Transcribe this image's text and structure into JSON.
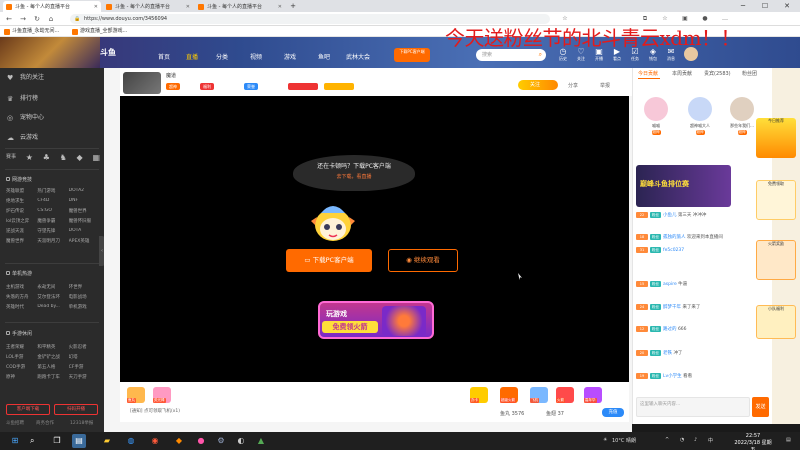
{
  "browser": {
    "tabs": [
      {
        "title": "斗鱼 - 每个人的直播平台",
        "active": true
      },
      {
        "title": "斗鱼 - 每个人的直播平台",
        "active": false
      },
      {
        "title": "斗鱼 - 每个人的直播平台",
        "active": false
      }
    ],
    "new_tab": "+",
    "url": "https://www.douyu.com/3456094",
    "bookmarks": [
      "斗鱼直播_永劫无间...",
      "游戏直播_全部游戏..."
    ]
  },
  "site": {
    "logo": "斗鱼",
    "nav": [
      "首页",
      "直播",
      "分类",
      "视频",
      "游戏",
      "鱼吧",
      "武林大会"
    ],
    "active_nav": "直播",
    "download_pc": "下载PC客户端",
    "search_placeholder": "搜索",
    "header_icons": [
      "历史",
      "关注",
      "开播",
      "看点",
      "任务",
      "钱包",
      "消息"
    ]
  },
  "sidebar": {
    "top_items": [
      {
        "icon": "♥",
        "label": "我的关注"
      },
      {
        "icon": "♛",
        "label": "排行榜"
      },
      {
        "icon": "◎",
        "label": "宠物中心"
      },
      {
        "icon": "☁",
        "label": "云游戏"
      }
    ],
    "quick_icons": [
      "赛事",
      "★",
      "♣",
      "♞",
      "◆",
      "▦"
    ],
    "section1": {
      "title": "网游竞技",
      "items": [
        "英雄联盟",
        "热门游戏",
        "DOTA2",
        "绝地求生",
        "CF4D",
        "DNF",
        "炉石传说",
        "CS:GO",
        "魔兽世界",
        "lol云顶之弈",
        "魔兽争霸",
        "魔兽怀旧服",
        "逆战天涯",
        "守望先锋",
        "DOTA",
        "魔兽世界",
        "天涯明月刀",
        "APEX英雄"
      ]
    },
    "section2": {
      "title": "单机热游",
      "items": [
        "主机游戏",
        "永劫无间",
        "环世界",
        "失落的方舟",
        "艾尔登法环",
        "电影战场",
        "英雄时代",
        "Dead by...",
        "单机游戏"
      ]
    },
    "section3": {
      "title": "手游休闲",
      "items": [
        "王者荣耀",
        "和平精英",
        "火影忍者",
        "LOL手游",
        "金铲铲之战",
        "幻塔",
        "COD手游",
        "第五人格",
        "CF手游",
        "原神",
        "跑跑卡丁车",
        "天刀手游"
      ]
    },
    "bottom_buttons": [
      "客户端下载",
      "扫码开播"
    ],
    "footer": [
      "斗鱼招聘",
      "商务合作",
      "12318举报"
    ]
  },
  "room": {
    "streamer": "魔道",
    "tags": [
      "超神",
      "福利",
      "荣誉"
    ],
    "follow": "关注",
    "share": "分享",
    "report": "举报"
  },
  "video": {
    "bubble_main": "还在卡顿吗？下载PC客户端",
    "bubble_sub": "去下载，看直播",
    "download_button": "下载PC客户端",
    "continue_button": "继续观看",
    "ad_line1": "玩游戏",
    "ad_line2": "免费领火箭"
  },
  "bottom_bar": {
    "gifts": [
      "鱼丸",
      "荧光棒",
      "办卡",
      "超级火箭",
      "飞机",
      "火箭",
      "嘉年华"
    ],
    "notice": "[通知] 点可领取飞机(x1)",
    "stats": [
      "鱼丸 3576",
      "鱼翅 37"
    ],
    "recharge": "充值"
  },
  "right_panel": {
    "tabs": [
      "今日贡献",
      "本周贡献",
      "贵宾(2583)",
      "粉丝团"
    ],
    "active_tab": "今日贡献",
    "contributors": [
      {
        "name": "喵喵",
        "badge": "超神"
      },
      {
        "name": "超神喵大人",
        "badge": "超神"
      },
      {
        "name": "那些年我们...",
        "badge": "超神"
      }
    ],
    "rank_banner": "巅峰斗鱼排位赛",
    "chat": [
      {
        "lv": "22",
        "fan": "粉丝",
        "user": "小鱼儿",
        "text": "第三天 冲冲冲"
      },
      {
        "lv": "18",
        "fan": "粉丝",
        "user": "孤独的旅人",
        "text": "欢迎来到本直播间"
      },
      {
        "lv": "31",
        "fan": "粉丝",
        "user": "fe5c0237",
        "text": ""
      },
      {
        "lv": "15",
        "fan": "粉丝",
        "user": "aspire",
        "text": "牛逼"
      },
      {
        "lv": "24",
        "fan": "粉丝",
        "user": "醉梦千年",
        "text": "来了来了"
      },
      {
        "lv": "12",
        "fan": "粉丝",
        "user": "路过的",
        "text": "666"
      },
      {
        "lv": "20",
        "fan": "粉丝",
        "user": "老铁",
        "text": "冲了"
      },
      {
        "lv": "19",
        "fan": "粉丝",
        "user": "Lv小学生",
        "text": "看看"
      }
    ],
    "chat_placeholder": "这里输入聊天内容...",
    "send": "发送"
  },
  "promo": [
    "今日推荐",
    "免费领取",
    "火箭奖励",
    "小队福利"
  ],
  "overlay_caption": "今天送粉丝节的北斗青云xdm！！",
  "taskbar": {
    "weather": "10°C 晴朗",
    "time": "22:57",
    "date": "2022/3/18 星期五"
  }
}
